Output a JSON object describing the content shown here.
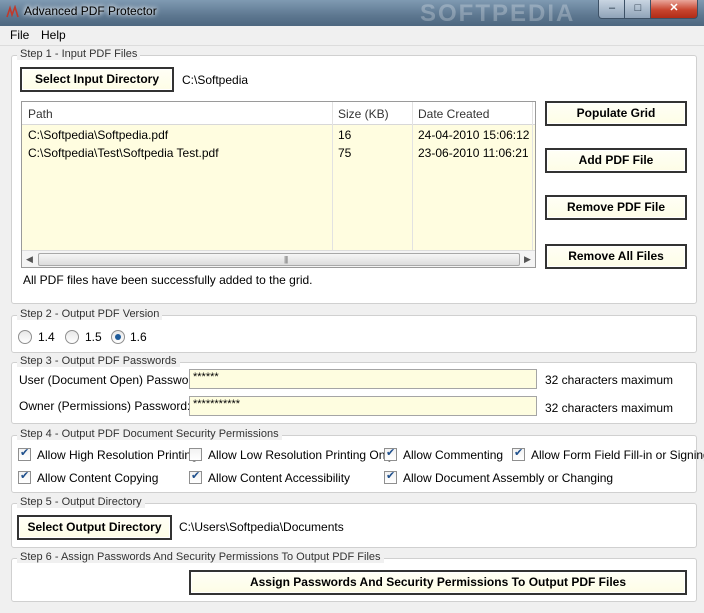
{
  "window": {
    "title": "Advanced PDF Protector",
    "watermark": "SOFTPEDIA",
    "controls": {
      "minimize": "–",
      "maximize": "□",
      "close": "✕"
    }
  },
  "menu": [
    "File",
    "Help"
  ],
  "step1": {
    "legend": "Step 1 - Input PDF Files",
    "select_button": "Select Input Directory",
    "input_dir": "C:\\Softpedia",
    "grid": {
      "columns": [
        "Path",
        "Size (KB)",
        "Date Created"
      ],
      "rows": [
        [
          "C:\\Softpedia\\Softpedia.pdf",
          "16",
          "24-04-2010 15:06:12"
        ],
        [
          "C:\\Softpedia\\Test\\Softpedia Test.pdf",
          "75",
          "23-06-2010 11:06:21"
        ]
      ]
    },
    "status": "All PDF files have been successfully added to the grid.",
    "buttons": {
      "populate": "Populate Grid",
      "add": "Add PDF File",
      "remove": "Remove PDF File",
      "remove_all": "Remove All Files"
    }
  },
  "step2": {
    "legend": "Step 2 - Output PDF Version",
    "options": [
      "1.4",
      "1.5",
      "1.6"
    ],
    "selected": "1.6"
  },
  "step3": {
    "legend": "Step 3 - Output PDF Passwords",
    "user_label": "User (Document Open) Password:",
    "user_value": "******",
    "owner_label": "Owner (Permissions) Password:",
    "owner_value": "***********",
    "hint": "32 characters maximum"
  },
  "step4": {
    "legend": "Step 4 - Output PDF Document Security Permissions",
    "permissions": [
      {
        "label": "Allow High Resolution Printing",
        "checked": true
      },
      {
        "label": "Allow Low Resolution Printing Only",
        "checked": false
      },
      {
        "label": "Allow Commenting",
        "checked": true
      },
      {
        "label": "Allow Form Field Fill-in or Signing",
        "checked": true
      },
      {
        "label": "Allow Content Copying",
        "checked": true
      },
      {
        "label": "Allow Content Accessibility",
        "checked": true
      },
      {
        "label": "Allow Document Assembly or Changing",
        "checked": true
      }
    ]
  },
  "step5": {
    "legend": "Step 5 - Output Directory",
    "button": "Select Output Directory",
    "output_dir": "C:\\Users\\Softpedia\\Documents"
  },
  "step6": {
    "legend": "Step 6 - Assign Passwords And Security Permissions To Output PDF Files",
    "button": "Assign Passwords And Security Permissions To Output PDF Files"
  }
}
